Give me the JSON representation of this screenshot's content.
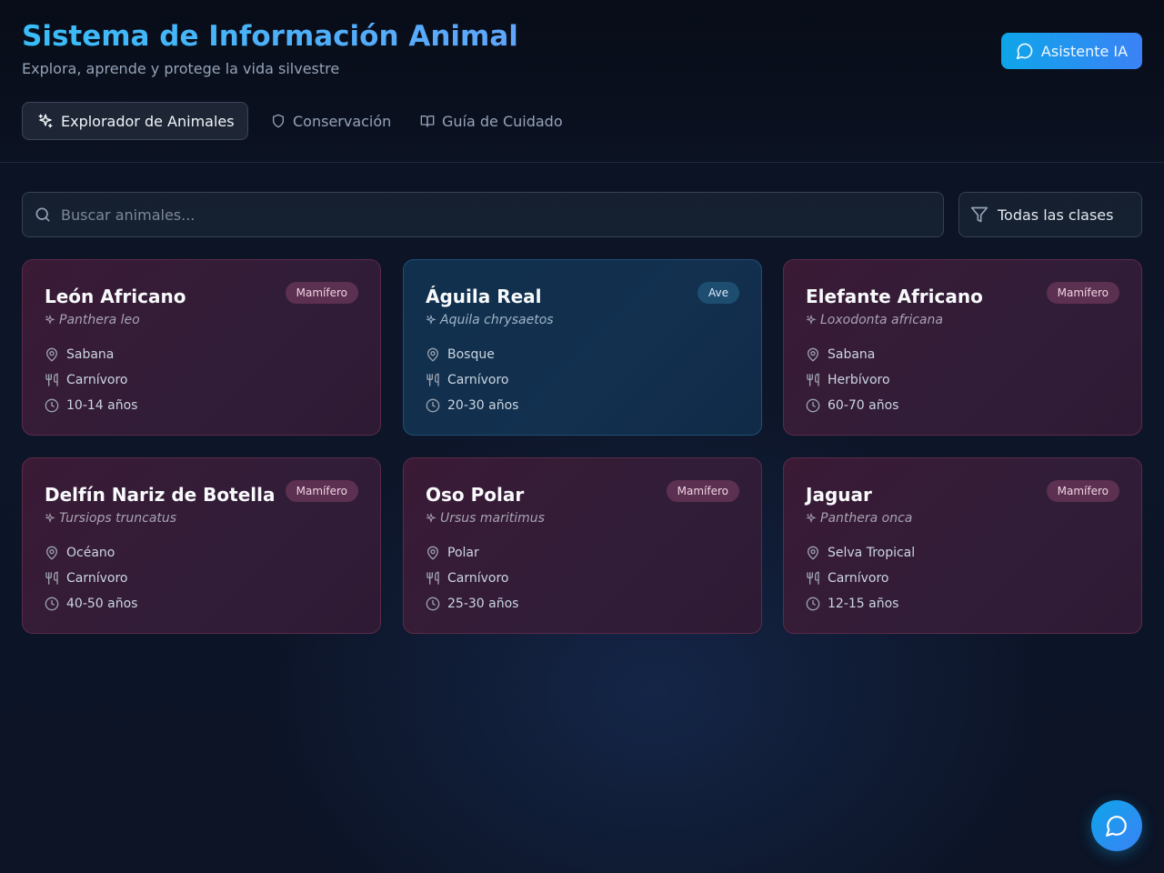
{
  "header": {
    "title": "Sistema de Información Animal",
    "subtitle": "Explora, aprende y protege la vida silvestre",
    "ai_button": {
      "label": "Asistente IA",
      "icon": "message-circle-icon"
    }
  },
  "tabs": [
    {
      "label": "Explorador de Animales",
      "icon": "sparkles-icon",
      "active": true
    },
    {
      "label": "Conservación",
      "icon": "shield-icon",
      "active": false
    },
    {
      "label": "Guía de Cuidado",
      "icon": "book-open-icon",
      "active": false
    }
  ],
  "search": {
    "placeholder": "Buscar animales...",
    "value": "",
    "icon": "search-icon"
  },
  "filter": {
    "selected": "Todas las clases",
    "icon": "filter-icon"
  },
  "animals": [
    {
      "name": "León Africano",
      "class": "Mamífero",
      "scientific": "Panthera leo",
      "habitat": "Sabana",
      "diet": "Carnívoro",
      "lifespan": "10-14 años"
    },
    {
      "name": "Águila Real",
      "class": "Ave",
      "scientific": "Aquila chrysaetos",
      "habitat": "Bosque",
      "diet": "Carnívoro",
      "lifespan": "20-30 años"
    },
    {
      "name": "Elefante Africano",
      "class": "Mamífero",
      "scientific": "Loxodonta africana",
      "habitat": "Sabana",
      "diet": "Herbívoro",
      "lifespan": "60-70 años"
    },
    {
      "name": "Delfín Nariz de Botella",
      "class": "Mamífero",
      "scientific": "Tursiops truncatus",
      "habitat": "Océano",
      "diet": "Carnívoro",
      "lifespan": "40-50 años"
    },
    {
      "name": "Oso Polar",
      "class": "Mamífero",
      "scientific": "Ursus maritimus",
      "habitat": "Polar",
      "diet": "Carnívoro",
      "lifespan": "25-30 años"
    },
    {
      "name": "Jaguar",
      "class": "Mamífero",
      "scientific": "Panthera onca",
      "habitat": "Selva Tropical",
      "diet": "Carnívoro",
      "lifespan": "12-15 años"
    }
  ],
  "chat_fab": {
    "icon": "message-circle-icon"
  },
  "colors": {
    "accent": "#0ea5e9",
    "title": "#38bdf8",
    "mammal_card": "#3a1a35",
    "bird_card": "#10304d"
  }
}
